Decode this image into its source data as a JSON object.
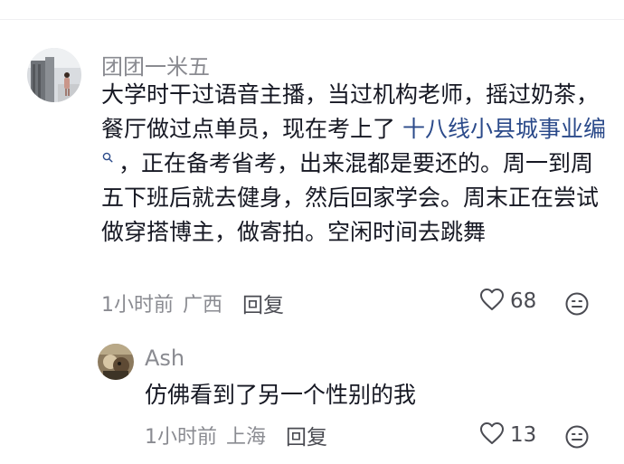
{
  "comments": [
    {
      "username": "团团一米五",
      "text_before": "大学时干过语音主播，当过机构老师，摇过奶茶，餐厅做过点单员，现在考上了 ",
      "link_text": "十八线小县城事业编",
      "text_after": "，正在备考省考，出来混都是要还的。周一到周五下班后就去健身，然后回家学会。周末正在尝试做穿搭博主，做寄拍。空闲时间去跳舞",
      "time": "1小时前",
      "location": "广西",
      "reply_label": "回复",
      "likes": "68"
    },
    {
      "username": "Ash",
      "text": "仿佛看到了另一个性别的我",
      "time": "1小时前",
      "location": "上海",
      "reply_label": "回复",
      "likes": "13"
    }
  ],
  "colors": {
    "link": "#2b4a8a",
    "meta": "#8a8b91",
    "text": "#161823"
  },
  "icons": [
    "avatar",
    "search-icon",
    "heart-icon",
    "emoji-icon"
  ]
}
